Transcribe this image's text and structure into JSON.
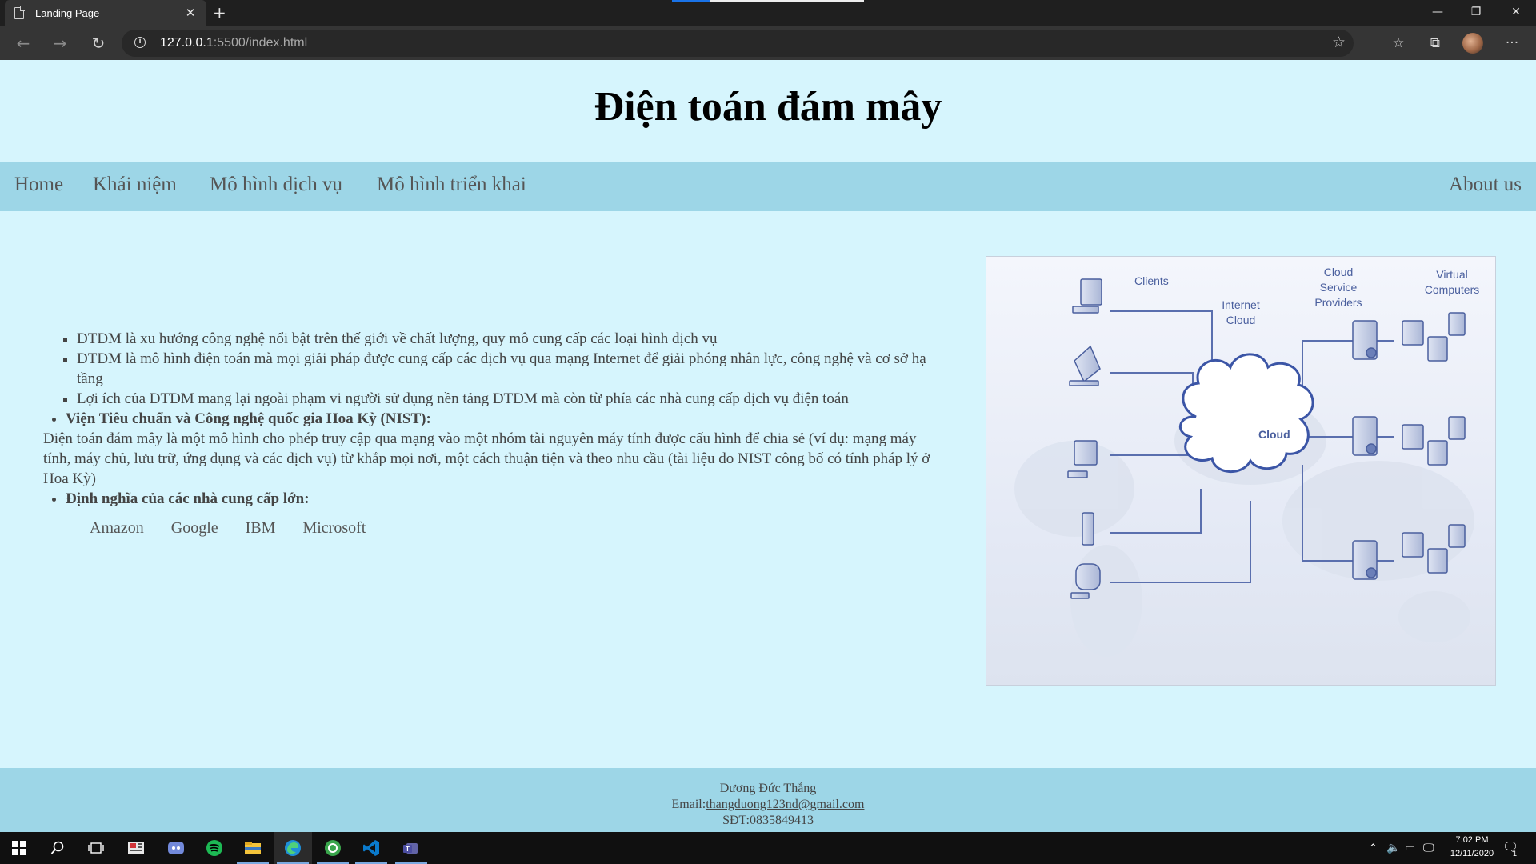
{
  "browser": {
    "tab_title": "Landing Page",
    "tab_close": "✕",
    "new_tab": "+",
    "url_host": "127.0.0.1",
    "url_rest": ":5500/index.html",
    "window_controls": [
      "—",
      "❐",
      "✕"
    ],
    "icons": [
      "document-icon",
      "back-icon",
      "forward-icon",
      "refresh-icon",
      "info-icon",
      "favorite-star-icon",
      "favorites-list-icon",
      "collections-icon",
      "profile-avatar",
      "more-icon"
    ]
  },
  "page": {
    "title": "Điện toán đám mây",
    "nav": [
      "Home",
      "Khái niệm",
      "Mô hình dịch vụ",
      "Mô hình triển khai"
    ],
    "nav_right": "About us",
    "bullets": [
      "ĐTĐM là xu hướng công nghệ nổi bật trên thế giới về chất lượng, quy mô cung cấp các loại hình dịch vụ",
      "ĐTĐM là mô hình điện toán mà mọi giải pháp được cung cấp các dịch vụ qua mạng Internet để giải phóng nhân lực, công nghệ và cơ sở hạ tầng",
      "Lợi ích của ĐTĐM mang lại ngoài phạm vi người sử dụng nền tảng ĐTĐM mà còn từ phía các nhà cung cấp dịch vụ điện toán"
    ],
    "nist_heading": "Viện Tiêu chuẩn và Công nghệ quốc gia Hoa Kỳ (NIST):",
    "nist_text": "Điện toán đám mây là một mô hình cho phép truy cập qua mạng vào một nhóm tài nguyên máy tính được cấu hình để chia sẻ (ví dụ: mạng máy tính, máy chủ, lưu trữ, ứng dụng và các dịch vụ) từ khắp mọi nơi, một cách thuận tiện và theo nhu cầu (tài liệu do NIST công bố có tính pháp lý ở Hoa Kỳ)",
    "providers_heading": "Định nghĩa của các nhà cung cấp lớn:",
    "providers": [
      "Amazon",
      "Google",
      "IBM",
      "Microsoft"
    ],
    "diagram": {
      "clients": "Clients",
      "internet_cloud_1": "Internet",
      "internet_cloud_2": "Cloud",
      "csp_1": "Cloud",
      "csp_2": "Service",
      "csp_3": "Providers",
      "vc_1": "Virtual",
      "vc_2": "Computers",
      "cloud": "Cloud"
    }
  },
  "footer": {
    "name": "Dương Đức Thắng",
    "email_label": "Email:",
    "email": "thangduong123nd@gmail.com",
    "phone": "SĐT:0835849413"
  },
  "taskbar": {
    "apps": [
      "windows-start-icon",
      "search-icon",
      "task-view-icon",
      "news-app-icon",
      "discord-icon",
      "spotify-icon",
      "file-explorer-icon",
      "edge-browser-icon",
      "green-app-icon",
      "vscode-icon",
      "teams-icon"
    ],
    "time": "7:02 PM",
    "date": "12/11/2020",
    "notification_count": "1"
  }
}
